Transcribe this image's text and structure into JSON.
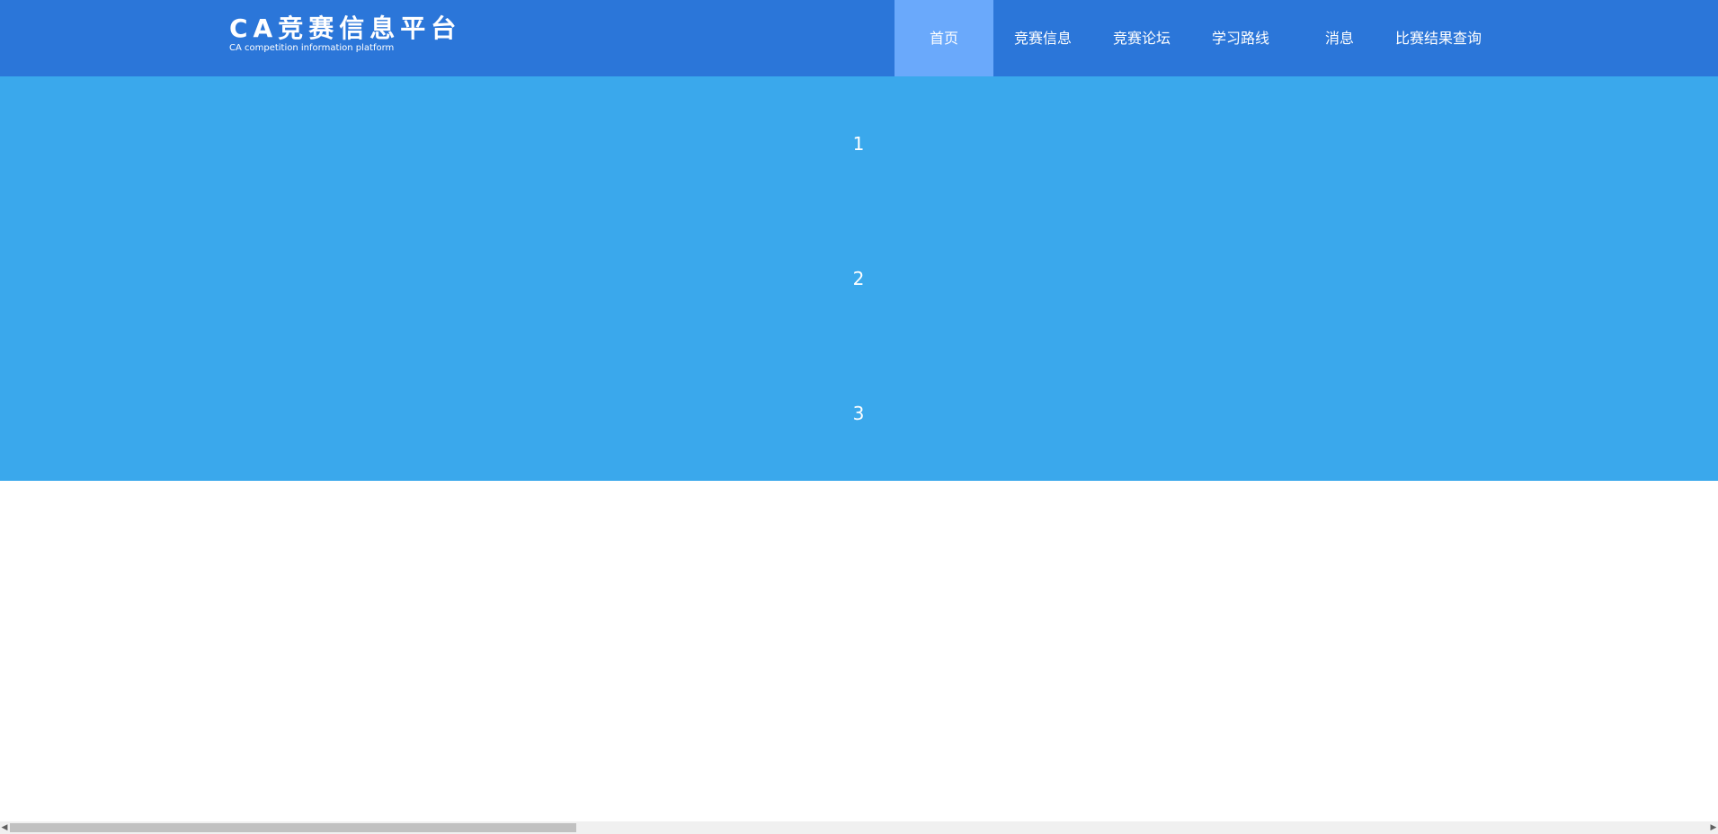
{
  "header": {
    "title": "CA竞赛信息平台",
    "subtitle": "CA competition information platform",
    "background_color": "#2b76d9"
  },
  "nav": {
    "items": [
      {
        "label": "首页",
        "active": true
      },
      {
        "label": "竞赛信息",
        "active": false
      },
      {
        "label": "竞赛论坛",
        "active": false
      },
      {
        "label": "学习路线",
        "active": false
      },
      {
        "label": "消息",
        "active": false
      },
      {
        "label": "比赛结果查询",
        "active": false
      }
    ],
    "active_color": "#6aa9fb"
  },
  "banner": {
    "background_color": "#3aa8ec",
    "slides": [
      "1",
      "2",
      "3"
    ]
  },
  "scrollbar": {
    "left_arrow": "◀",
    "right_arrow": "▶"
  }
}
